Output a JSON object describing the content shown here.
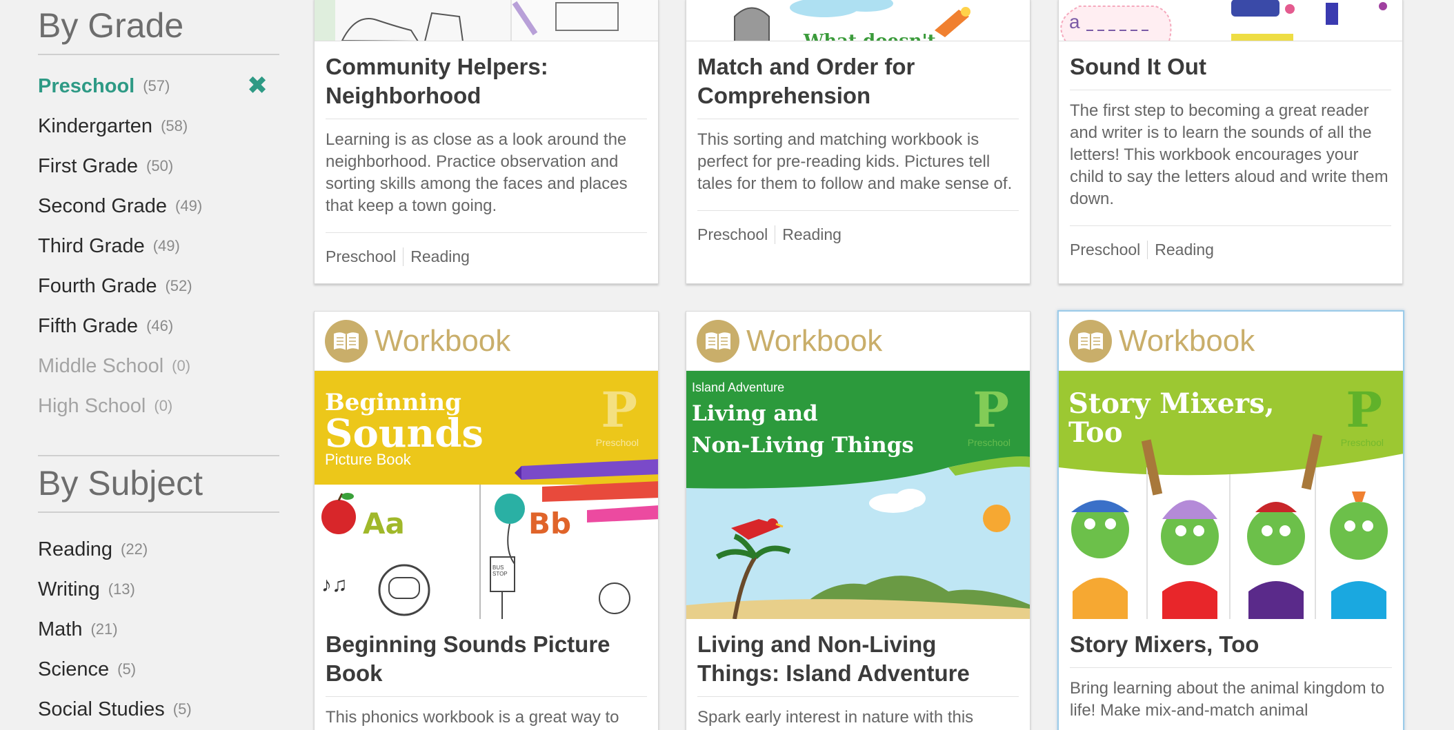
{
  "sidebar": {
    "grade_title": "By Grade",
    "grades": [
      {
        "label": "Preschool",
        "count": "(57)"
      },
      {
        "label": "Kindergarten",
        "count": "(58)"
      },
      {
        "label": "First Grade",
        "count": "(50)"
      },
      {
        "label": "Second Grade",
        "count": "(49)"
      },
      {
        "label": "Third Grade",
        "count": "(49)"
      },
      {
        "label": "Fourth Grade",
        "count": "(52)"
      },
      {
        "label": "Fifth Grade",
        "count": "(46)"
      },
      {
        "label": "Middle School",
        "count": "(0)"
      },
      {
        "label": "High School",
        "count": "(0)"
      }
    ],
    "clear_icon": "✖",
    "subject_title": "By Subject",
    "subjects": [
      {
        "label": "Reading",
        "count": "(22)"
      },
      {
        "label": "Writing",
        "count": "(13)"
      },
      {
        "label": "Math",
        "count": "(21)"
      },
      {
        "label": "Science",
        "count": "(5)"
      },
      {
        "label": "Social Studies",
        "count": "(5)"
      }
    ]
  },
  "cards_top": [
    {
      "title": "Community Helpers: Neighborhood",
      "description": "Learning is as close as a look around the neighborhood. Practice observation and sorting skills among the faces and places that keep a town going.",
      "tags": [
        "Preschool",
        "Reading"
      ]
    },
    {
      "title": "Match and Order for Comprehension",
      "description": "This sorting and matching workbook is perfect for pre-reading kids. Pictures tell tales for them to follow and make sense of.",
      "tags": [
        "Preschool",
        "Reading"
      ],
      "thumb_text": "What doesn't"
    },
    {
      "title": "Sound It Out",
      "description": "The first step to becoming a great reader and writer is to learn the sounds of all the letters! This workbook encourages your child to say the letters aloud and write them down.",
      "tags": [
        "Preschool",
        "Reading"
      ]
    }
  ],
  "cards_bottom": [
    {
      "type_label": "Workbook",
      "title": "Beginning Sounds Picture Book",
      "description": "This phonics workbook is a great way to",
      "cover": {
        "line1": "Beginning",
        "line2": "Sounds",
        "line3": "Picture Book",
        "grade_letter": "P",
        "grade_word": "Preschool",
        "letter_a": "Aa",
        "letter_b": "Bb",
        "sign": "BUS STOP"
      }
    },
    {
      "type_label": "Workbook",
      "title": "Living and Non-Living Things: Island Adventure",
      "description": "Spark early interest in nature with this",
      "cover": {
        "kicker": "Island Adventure",
        "line1": "Living and",
        "line2": "Non-Living Things",
        "grade_letter": "P",
        "grade_word": "Preschool"
      }
    },
    {
      "type_label": "Workbook",
      "title": "Story Mixers, Too",
      "description": "Bring learning about the animal kingdom to life! Make mix-and-match animal",
      "cover": {
        "line1": "Story Mixers,",
        "line2": "Too",
        "grade_letter": "P",
        "grade_word": "Preschool"
      }
    }
  ],
  "colors": {
    "accent": "#2e9a85",
    "workbook_gold": "#c9ae6a",
    "highlight_border": "#9bcbe9"
  }
}
